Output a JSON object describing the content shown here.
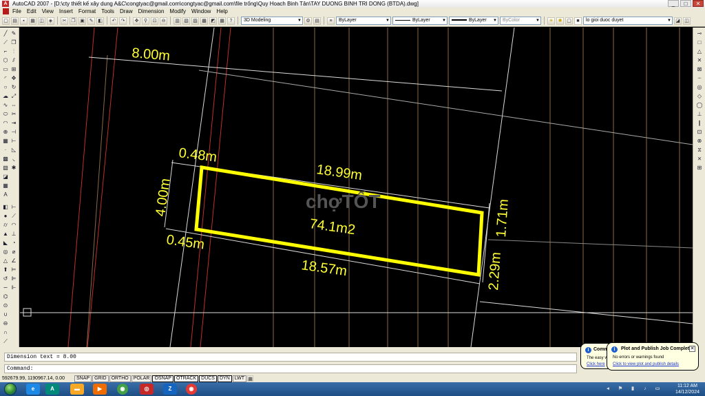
{
  "window": {
    "title": "AutoCAD 2007 - [D:\\cty thiết kế xây dung A&C\\congtyac@gmail.com\\congtyac@gmail.com\\file trống\\Quy Hoach Binh Tân\\TAY DUONG BINH TRI DONG (BTDA).dwg]",
    "minimize": "_",
    "maximize": "□",
    "close": "✕"
  },
  "menu": [
    "File",
    "Edit",
    "View",
    "Insert",
    "Format",
    "Tools",
    "Draw",
    "Dimension",
    "Modify",
    "Window",
    "Help"
  ],
  "toolbar": {
    "workspace": "3D Modeling",
    "layer_color": "ByLayer",
    "linetype": "ByLayer",
    "lineweight": "ByLayer",
    "plotstyle": "ByColor",
    "layer_name": "lo gioi duoc duyet"
  },
  "drawing": {
    "dim_top_left": "8.00m",
    "dim_small_top": "0.48m",
    "dim_long_top": "18.99m",
    "dim_left": "4.00m",
    "area": "74.1m2",
    "dim_small_bottom": "0.45m",
    "dim_long_bottom": "18.57m",
    "dim_right_top": "1.71m",
    "dim_right_bottom": "2.29m",
    "watermark": "chợTỐT",
    "colors": {
      "outline": "#ffff00",
      "dim": "#ffff33",
      "grid_red": "#c0302a",
      "grid_white": "#dcdcdc",
      "grid_brown": "#8a6a4a"
    }
  },
  "command": {
    "history": "Dimension text = 8.00",
    "prompt": "Command:"
  },
  "status": {
    "coords": "592679.99, 1190967.14, 0.00",
    "buttons": [
      "SNAP",
      "GRID",
      "ORTHO",
      "POLAR",
      "OSNAP",
      "OTRACK",
      "DUCS",
      "DYN",
      "LWT"
    ],
    "on_buttons": [
      "OSNAP",
      "OTRACK",
      "DUCS",
      "DYN"
    ]
  },
  "balloon_back": {
    "title": "Comm",
    "body": "The easy w",
    "link": "Click here"
  },
  "balloon_front": {
    "title": "Plot and Publish Job Complete",
    "body": "No errors or warnings found",
    "link": "Click to view plot and publish details"
  },
  "clock": {
    "time": "11:12 AM",
    "date": "14/12/2024"
  }
}
